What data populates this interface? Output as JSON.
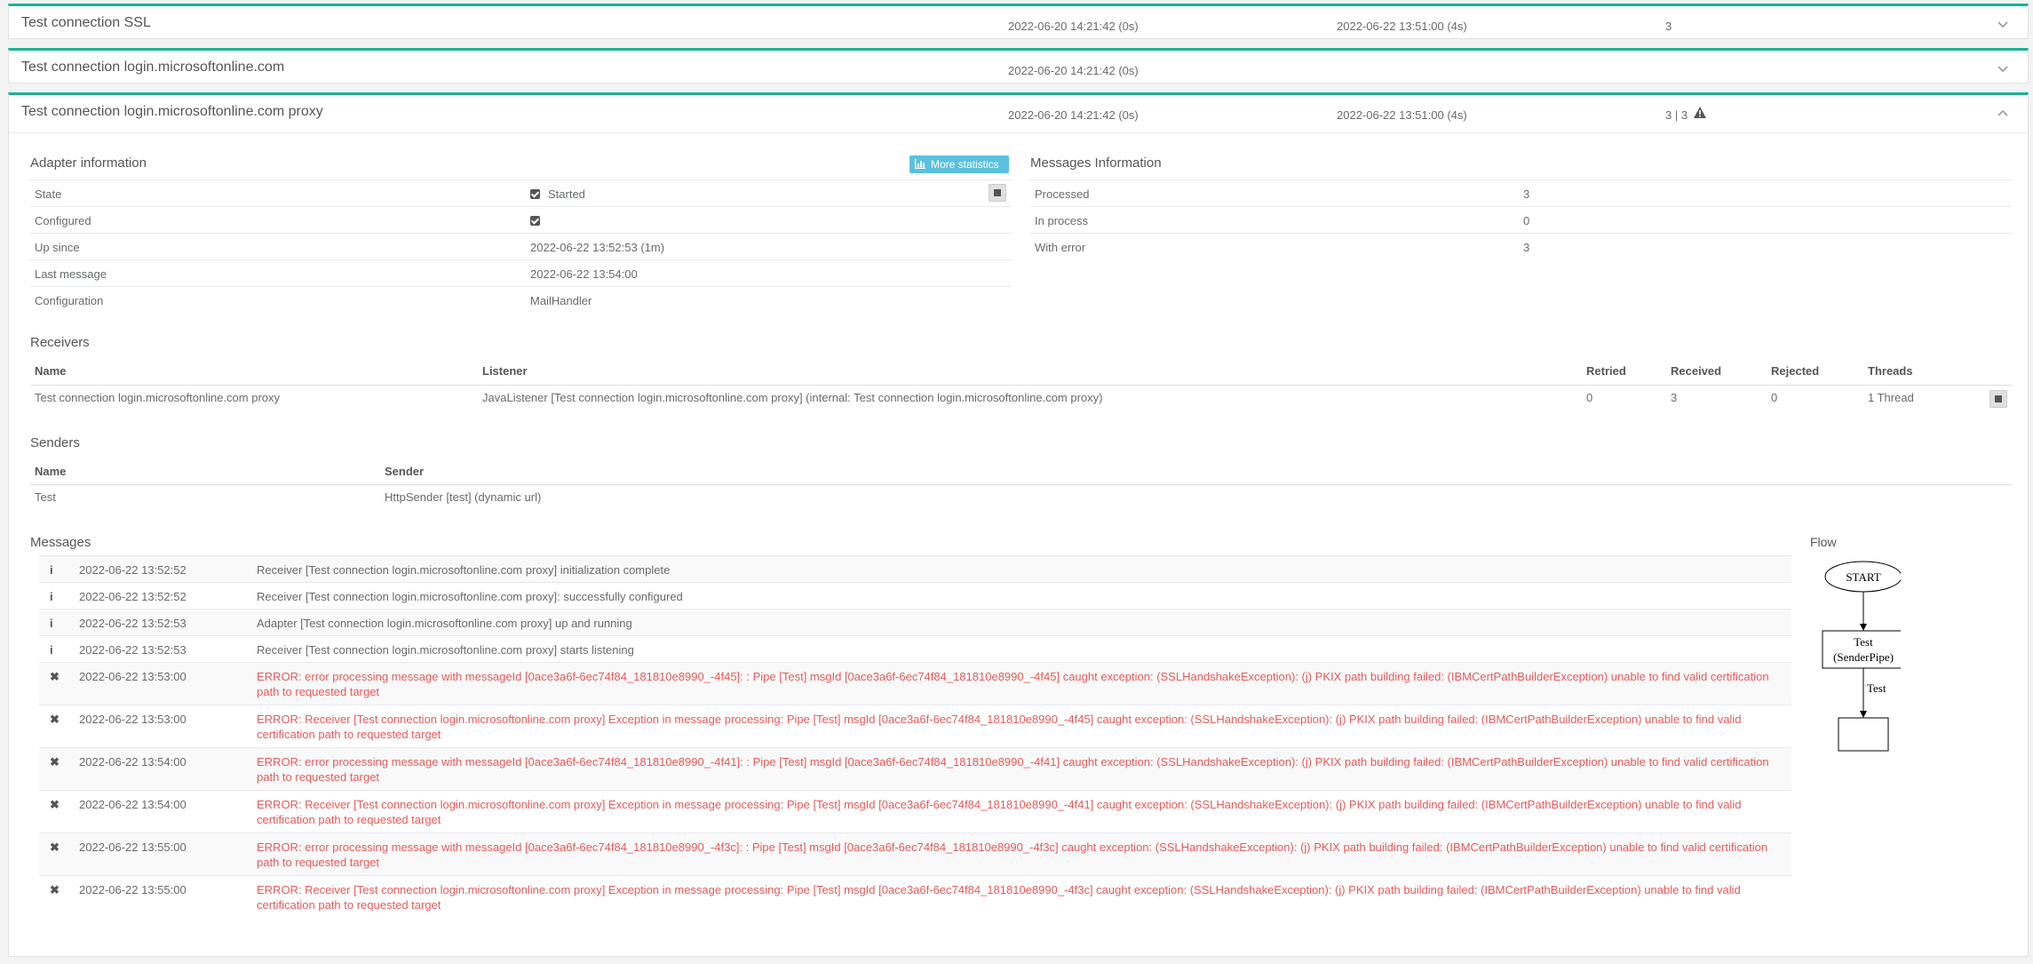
{
  "adapters": [
    {
      "name": "Test connection SSL",
      "col1": "2022-06-20 14:21:42 (0s)",
      "col2": "2022-06-22 13:51:00 (4s)",
      "col3": "3"
    },
    {
      "name": "Test connection login.microsoftonline.com",
      "col1": "2022-06-20 14:21:42 (0s)",
      "col2": "",
      "col3": ""
    },
    {
      "name": "Test connection login.microsoftonline.com proxy",
      "col1": "2022-06-20 14:21:42 (0s)",
      "col2": "2022-06-22 13:51:00 (4s)",
      "col3": "3 | 3"
    }
  ],
  "adapter_info": {
    "title": "Adapter information",
    "more_stats": "More statistics",
    "rows": [
      {
        "label": "State",
        "value": "Started"
      },
      {
        "label": "Configured",
        "value": ""
      },
      {
        "label": "Up since",
        "value": "2022-06-22 13:52:53 (1m)"
      },
      {
        "label": "Last message",
        "value": "2022-06-22 13:54:00"
      },
      {
        "label": "Configuration",
        "value": "MailHandler"
      }
    ]
  },
  "messages_info": {
    "title": "Messages Information",
    "rows": [
      {
        "label": "Processed",
        "value": "3"
      },
      {
        "label": "In process",
        "value": "0"
      },
      {
        "label": "With error",
        "value": "3"
      }
    ]
  },
  "receivers": {
    "title": "Receivers",
    "headers": [
      "Name",
      "Listener",
      "Retried",
      "Received",
      "Rejected",
      "Threads"
    ],
    "row": [
      "Test connection login.microsoftonline.com proxy",
      "JavaListener [Test connection login.microsoftonline.com proxy] (internal: Test connection login.microsoftonline.com proxy)",
      "0",
      "3",
      "0",
      "1 Thread"
    ]
  },
  "senders": {
    "title": "Senders",
    "headers": [
      "Name",
      "Sender"
    ],
    "row": [
      "Test",
      "HttpSender [test] (dynamic url)"
    ]
  },
  "messages": {
    "title": "Messages",
    "rows": [
      {
        "icon": "info-icon",
        "glyph": "i",
        "time": "2022-06-22 13:52:52",
        "text": "Receiver [Test connection login.microsoftonline.com proxy] initialization complete"
      },
      {
        "icon": "info-icon",
        "glyph": "i",
        "time": "2022-06-22 13:52:52",
        "text": "Receiver [Test connection login.microsoftonline.com proxy]: successfully configured"
      },
      {
        "icon": "info-icon",
        "glyph": "i",
        "time": "2022-06-22 13:52:53",
        "text": "Adapter [Test connection login.microsoftonline.com proxy] up and running"
      },
      {
        "icon": "info-icon",
        "glyph": "i",
        "time": "2022-06-22 13:52:53",
        "text": "Receiver [Test connection login.microsoftonline.com proxy] starts listening"
      },
      {
        "icon": "error-icon",
        "glyph": "✖",
        "time": "2022-06-22 13:53:00",
        "text": "ERROR: error processing message with messageId [0ace3a6f-6ec74f84_181810e8990_-4f45]: : Pipe [Test] msgId [0ace3a6f-6ec74f84_181810e8990_-4f45] caught exception: (SSLHandshakeException): (j) PKIX path building failed: (IBMCertPathBuilderException) unable to find valid certification path to requested target"
      },
      {
        "icon": "error-icon",
        "glyph": "✖",
        "time": "2022-06-22 13:53:00",
        "text": "ERROR: Receiver [Test connection login.microsoftonline.com proxy] Exception in message processing: Pipe [Test] msgId [0ace3a6f-6ec74f84_181810e8990_-4f45] caught exception: (SSLHandshakeException): (j) PKIX path building failed: (IBMCertPathBuilderException) unable to find valid certification path to requested target"
      },
      {
        "icon": "error-icon",
        "glyph": "✖",
        "time": "2022-06-22 13:54:00",
        "text": "ERROR: error processing message with messageId [0ace3a6f-6ec74f84_181810e8990_-4f41]: : Pipe [Test] msgId [0ace3a6f-6ec74f84_181810e8990_-4f41] caught exception: (SSLHandshakeException): (j) PKIX path building failed: (IBMCertPathBuilderException) unable to find valid certification path to requested target"
      },
      {
        "icon": "error-icon",
        "glyph": "✖",
        "time": "2022-06-22 13:54:00",
        "text": "ERROR: Receiver [Test connection login.microsoftonline.com proxy] Exception in message processing: Pipe [Test] msgId [0ace3a6f-6ec74f84_181810e8990_-4f41] caught exception: (SSLHandshakeException): (j) PKIX path building failed: (IBMCertPathBuilderException) unable to find valid certification path to requested target"
      },
      {
        "icon": "error-icon",
        "glyph": "✖",
        "time": "2022-06-22 13:55:00",
        "text": "ERROR: error processing message with messageId [0ace3a6f-6ec74f84_181810e8990_-4f3c]: : Pipe [Test] msgId [0ace3a6f-6ec74f84_181810e8990_-4f3c] caught exception: (SSLHandshakeException): (j) PKIX path building failed: (IBMCertPathBuilderException) unable to find valid certification path to requested target"
      },
      {
        "icon": "error-icon",
        "glyph": "✖",
        "time": "2022-06-22 13:55:00",
        "text": "ERROR: Receiver [Test connection login.microsoftonline.com proxy] Exception in message processing: Pipe [Test] msgId [0ace3a6f-6ec74f84_181810e8990_-4f3c] caught exception: (SSLHandshakeException): (j) PKIX path building failed: (IBMCertPathBuilderException) unable to find valid certification path to requested target"
      }
    ]
  },
  "flow": {
    "title": "Flow",
    "start": "START",
    "pipe_line1": "Test",
    "pipe_line2": "(SenderPipe)",
    "edge_label": "Test"
  },
  "colors": {
    "accent": "#1ab394",
    "error": "#e35b5a",
    "info_button": "#5bc0de",
    "text": "#676a6c"
  }
}
